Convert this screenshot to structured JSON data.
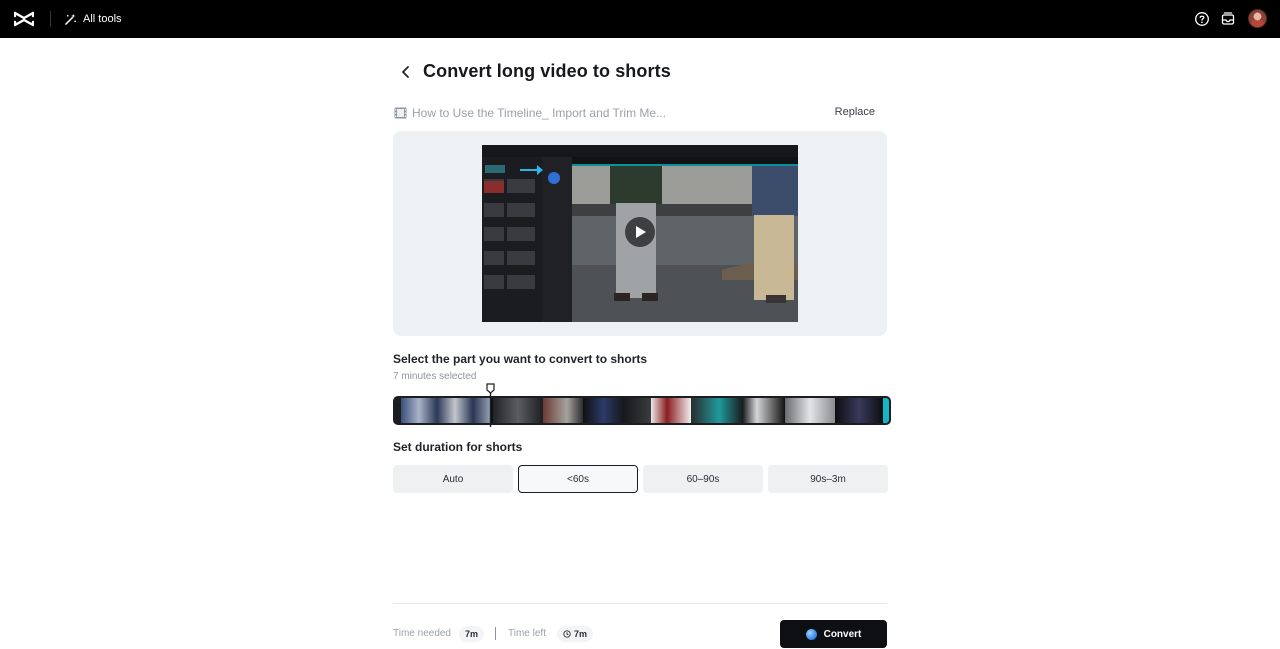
{
  "topbar": {
    "all_tools_label": "All tools",
    "icons": [
      "capcut-logo-icon",
      "magic-wand-icon",
      "help-icon",
      "inbox-icon",
      "avatar"
    ]
  },
  "header": {
    "title": "Convert long video to shorts"
  },
  "file": {
    "name": "How to Use the Timeline_ Import and Trim Me...",
    "replace_label": "Replace"
  },
  "selection": {
    "heading": "Select the part you want to convert to shorts",
    "selected_text": "7 minutes selected"
  },
  "duration": {
    "heading": "Set duration for shorts",
    "options": [
      "Auto",
      "<60s",
      "60–90s",
      "90s–3m"
    ],
    "selected": "<60s"
  },
  "footer": {
    "time_needed_label": "Time needed",
    "time_needed_value": "7m",
    "time_left_label": "Time left",
    "time_left_value": "7m",
    "convert_label": "Convert"
  },
  "colors": {
    "topbar": "#000000",
    "accent": "#14b7c4",
    "primary_button": "#0d0f13"
  }
}
